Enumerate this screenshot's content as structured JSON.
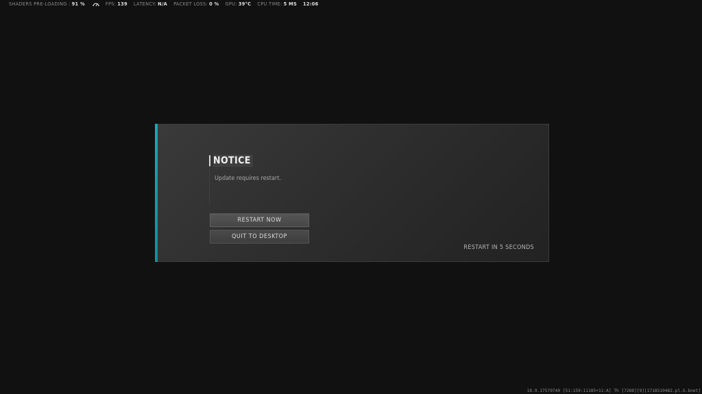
{
  "telemetry": {
    "shaders_label": "SHADERS PRE-LOADING :",
    "shaders_value": "91 %",
    "fps_label": "FPS:",
    "fps_value": "139",
    "latency_label": "LATENCY:",
    "latency_value": "N/A",
    "packet_loss_label": "PACKET LOSS:",
    "packet_loss_value": "0 %",
    "gpu_label": "GPU:",
    "gpu_value": "39°C",
    "cpu_time_label": "CPU TIME:",
    "cpu_time_value": "5 MS",
    "clock": "12:06",
    "gauge_icon": "speedometer-icon"
  },
  "dialog": {
    "title": "NOTICE",
    "message": "Update requires restart.",
    "restart_now_label": "RESTART NOW",
    "quit_label": "QUIT TO DESKTOP",
    "countdown": "RESTART IN 5 SECONDS",
    "accent_color": "#1aa6b7"
  },
  "build_info": "18.9.17579740 [51:159:11185+11:A] Th [7288][9][1718510482.pl.G.bnet]"
}
